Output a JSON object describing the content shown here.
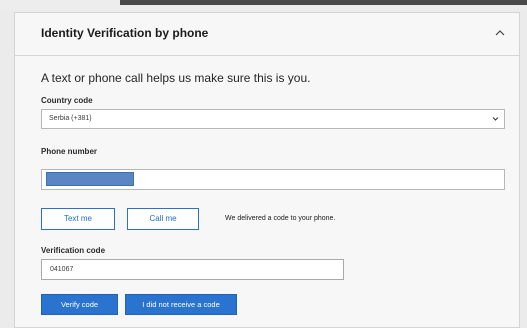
{
  "section": {
    "title": "Identity Verification by phone",
    "intro": "A text or phone call helps us make sure this is you."
  },
  "country": {
    "label": "Country code",
    "selected": "Serbia (+381)"
  },
  "phone": {
    "label": "Phone number",
    "value_redacted": true
  },
  "actions": {
    "text_me": "Text me",
    "call_me": "Call me",
    "status": "We delivered a code to your phone."
  },
  "verification": {
    "label": "Verification code",
    "value": "041067",
    "verify_button": "Verify code",
    "not_received_button": "I did not receive a code"
  },
  "colors": {
    "accent": "#2a74cf",
    "redaction": "#5b86c4"
  }
}
